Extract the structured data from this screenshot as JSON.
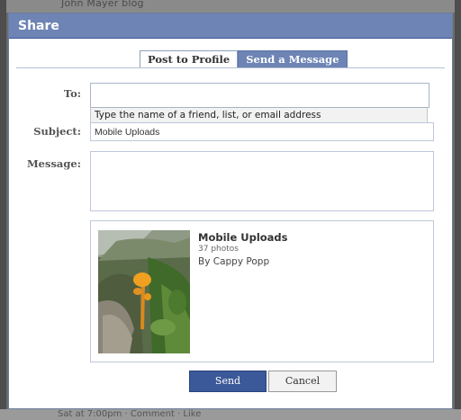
{
  "background": {
    "top_text": "John Mayer blog",
    "bottom_text": "Sat at 7:00pm · Comment · Like"
  },
  "dialog": {
    "title": "Share"
  },
  "tabs": [
    {
      "label": "Post to Profile",
      "active": true
    },
    {
      "label": "Send a Message",
      "active": false
    }
  ],
  "form": {
    "to_label": "To:",
    "to_value": "",
    "to_suggestion": "Type the name of a friend, list, or email address",
    "subject_label": "Subject:",
    "subject_value": "Mobile Uploads",
    "message_label": "Message:",
    "message_value": ""
  },
  "attachment": {
    "title": "Mobile Uploads",
    "count": "37 photos",
    "author": "By Cappy Popp"
  },
  "buttons": {
    "send": "Send",
    "cancel": "Cancel"
  },
  "colors": {
    "title_bar": "#6d84b4",
    "send_button": "#3b5998",
    "inactive_tab": "#6d84b4"
  }
}
